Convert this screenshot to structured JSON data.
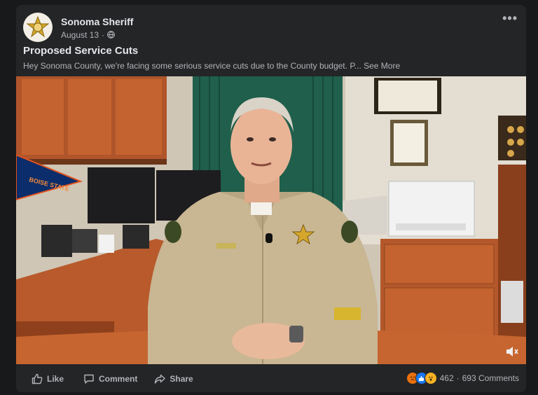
{
  "post": {
    "page_name": "Sonoma Sheriff",
    "date": "August 13",
    "separator": "·",
    "privacy_icon": "globe-icon",
    "more_icon": "ellipsis-icon",
    "more_label": "•••",
    "title": "Proposed Service Cuts",
    "text": "Hey Sonoma County, we're facing some serious service cuts due to the County budget. P...",
    "see_more": "See More"
  },
  "video": {
    "pennant_text": "BOISE STATE",
    "volume_icon": "volume-muted-icon"
  },
  "actions": {
    "like": "Like",
    "comment": "Comment",
    "share": "Share"
  },
  "stats": {
    "reaction_icons": [
      "angry-reaction-icon",
      "like-reaction-icon",
      "wow-reaction-icon"
    ],
    "reaction_count": "462",
    "separator": "·",
    "comments": "693 Comments"
  },
  "colors": {
    "background": "#18191a",
    "card": "#242526",
    "text_primary": "#e4e6eb",
    "text_secondary": "#b0b3b8",
    "like_blue": "#1877f2",
    "angry": "#e9710f",
    "wow": "#f7b125"
  }
}
